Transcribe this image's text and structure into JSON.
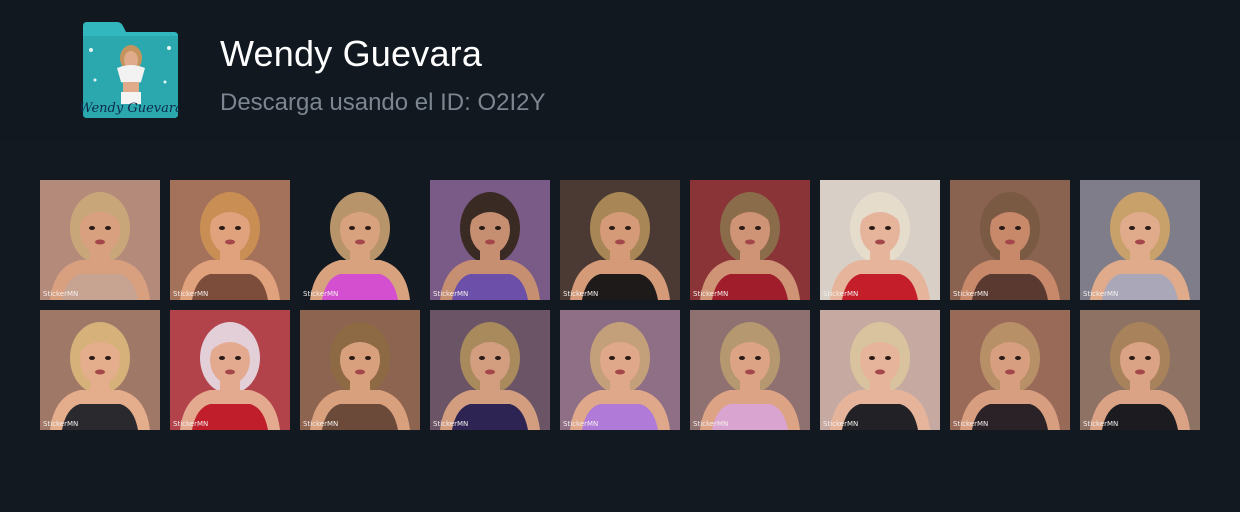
{
  "pack": {
    "title": "Wendy Guevara",
    "subtitle": "Descarga usando el ID: O2I2Y",
    "icon_caption": "Wendy Guevara"
  },
  "watermark": "StickerMN",
  "colors": {
    "background": "#121921",
    "header_bg": "#111820",
    "title": "#ffffff",
    "subtitle": "#7c8590",
    "folder": "#31b7bd"
  },
  "stickers": [
    {
      "name": "sticker-1",
      "bg": "#b48a7a",
      "hair": "#c9a679",
      "skin": "#d9a080",
      "top": "#c7a391"
    },
    {
      "name": "sticker-2",
      "bg": "#a4725a",
      "hair": "#c98e54",
      "skin": "#dfa27d",
      "top": "#7d4d3c"
    },
    {
      "name": "sticker-3",
      "bg": "#121921",
      "hair": "#b8946a",
      "skin": "#d9a27f",
      "top": "#d34fd0"
    },
    {
      "name": "sticker-4",
      "bg": "#7a5a86",
      "hair": "#3a2a24",
      "skin": "#c68f72",
      "top": "#6b4fa8"
    },
    {
      "name": "sticker-5",
      "bg": "#4a3a33",
      "hair": "#a88656",
      "skin": "#d59b79",
      "top": "#1e1a1a"
    },
    {
      "name": "sticker-6",
      "bg": "#8a3438",
      "hair": "#8a6b4a",
      "skin": "#cf9475",
      "top": "#a01e2c"
    },
    {
      "name": "sticker-7",
      "bg": "#d8cfc7",
      "hair": "#e6dccb",
      "skin": "#e6b49a",
      "top": "#c41e2a"
    },
    {
      "name": "sticker-8",
      "bg": "#8a6250",
      "hair": "#7b5a44",
      "skin": "#c8896a",
      "top": "#5a3a30"
    },
    {
      "name": "sticker-9",
      "bg": "#7f7d8a",
      "hair": "#c8a06a",
      "skin": "#e0ab8a",
      "top": "#a9a7b8"
    },
    {
      "name": "sticker-10",
      "bg": "#a07868",
      "hair": "#d6b27a",
      "skin": "#e4ad8c",
      "top": "#2a2a2e"
    },
    {
      "name": "sticker-11",
      "bg": "#b2434a",
      "hair": "#e3cfd8",
      "skin": "#e4aa90",
      "top": "#c01e2a"
    },
    {
      "name": "sticker-12",
      "bg": "#8c6450",
      "hair": "#8e6a44",
      "skin": "#d9a07e",
      "top": "#6b4a3a"
    },
    {
      "name": "sticker-13",
      "bg": "#6a5466",
      "hair": "#a98a5c",
      "skin": "#d39e80",
      "top": "#2e2454"
    },
    {
      "name": "sticker-14",
      "bg": "#8e6f86",
      "hair": "#c4a07a",
      "skin": "#e0a88a",
      "top": "#b07ad8"
    },
    {
      "name": "sticker-15",
      "bg": "#8e7170",
      "hair": "#b59770",
      "skin": "#dda385",
      "top": "#d9a4cf"
    },
    {
      "name": "sticker-16",
      "bg": "#c6a9a0",
      "hair": "#d9c39e",
      "skin": "#e6b49a",
      "top": "#222226"
    },
    {
      "name": "sticker-17",
      "bg": "#9a6a58",
      "hair": "#b89068",
      "skin": "#d89e80",
      "top": "#2a2226"
    },
    {
      "name": "sticker-18",
      "bg": "#8e7264",
      "hair": "#a8825a",
      "skin": "#dba385",
      "top": "#1c1c20"
    }
  ]
}
